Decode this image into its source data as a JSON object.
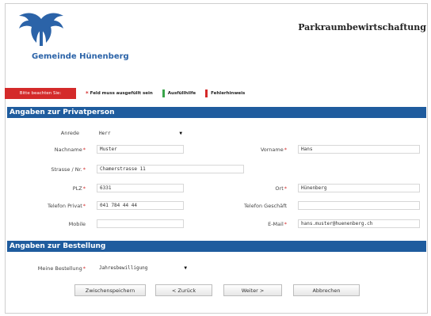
{
  "header": {
    "town_name": "Gemeinde Hünenberg",
    "app_title": "Parkraumbewirtschaftung"
  },
  "legend": {
    "pill_label": "Bitte beachten Sie:",
    "required_label": "Feld muss ausgefüllt sein",
    "help_label": "Ausfüllhilfe",
    "error_label": "Fehlerhinweis",
    "colors": {
      "pill": "#d42a2a",
      "help": "#3aa54a",
      "error": "#d42a2a"
    }
  },
  "sections": {
    "private": "Angaben zur Privatperson",
    "order": "Angaben zur Bestellung"
  },
  "form": {
    "anrede": {
      "label": "Anrede",
      "value": "Herr"
    },
    "nachname": {
      "label": "Nachname",
      "value": "Muster"
    },
    "vorname": {
      "label": "Vorname",
      "value": "Hans"
    },
    "strasse": {
      "label": "Strasse / Nr.",
      "value": "Chamerstrasse 11"
    },
    "plz": {
      "label": "PLZ",
      "value": "6331"
    },
    "ort": {
      "label": "Ort",
      "value": "Hünenberg"
    },
    "tel_privat": {
      "label": "Telefon Privat",
      "value": "041 784 44 44"
    },
    "tel_geschaeft": {
      "label": "Telefon Geschäft",
      "value": ""
    },
    "mobile": {
      "label": "Mobile",
      "value": ""
    },
    "email": {
      "label": "E-Mail",
      "value": "hans.muster@huenenberg.ch"
    },
    "bestellung": {
      "label": "Meine Bestellung",
      "value": "Jahresbewilligung"
    },
    "required_mark": "*"
  },
  "buttons": {
    "save": "Zwischenspeichern",
    "back": "< Zurück",
    "next": "Weiter >",
    "cancel": "Abbrechen"
  },
  "icons": {
    "logo": "crest-horns-icon",
    "dropdown": "caret-down-icon"
  }
}
